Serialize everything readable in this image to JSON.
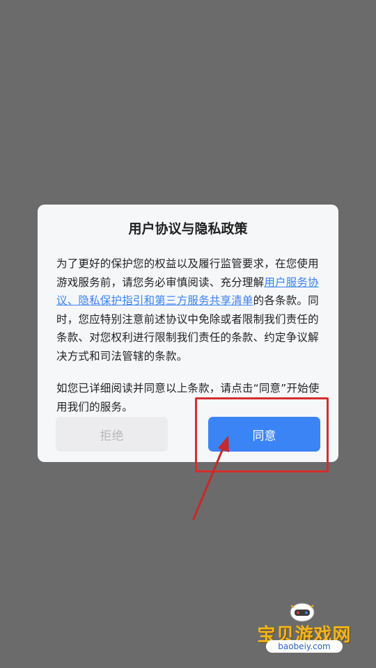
{
  "dialog": {
    "title": "用户协议与隐私政策",
    "para1_before": "为了更好的保护您的权益以及履行监管要求，在您使用游戏服务前，请您务必审慎阅读、充分理解",
    "para1_link": "用户服务协议、隐私保护指引和第三方服务共享清单",
    "para1_after": "的各条款。同时，您应特别注意前述协议中免除或者限制我们责任的条款、对您权利进行限制我们责任的条款、约定争议解决方式和司法管辖的条款。",
    "para2": "如您已详细阅读并同意以上条款，请点击“同意”开始使用我们的服务。",
    "reject_label": "拒绝",
    "agree_label": "同意"
  },
  "watermark": {
    "title": "宝贝游戏网",
    "url": "baobeiy.com"
  },
  "colors": {
    "overlay": "#6b6b6b",
    "dialog_bg": "#f6f7f9",
    "link": "#3b82f6",
    "agree_button": "#3b84f5",
    "reject_button": "#ececee",
    "annotation": "#d62d2d"
  }
}
